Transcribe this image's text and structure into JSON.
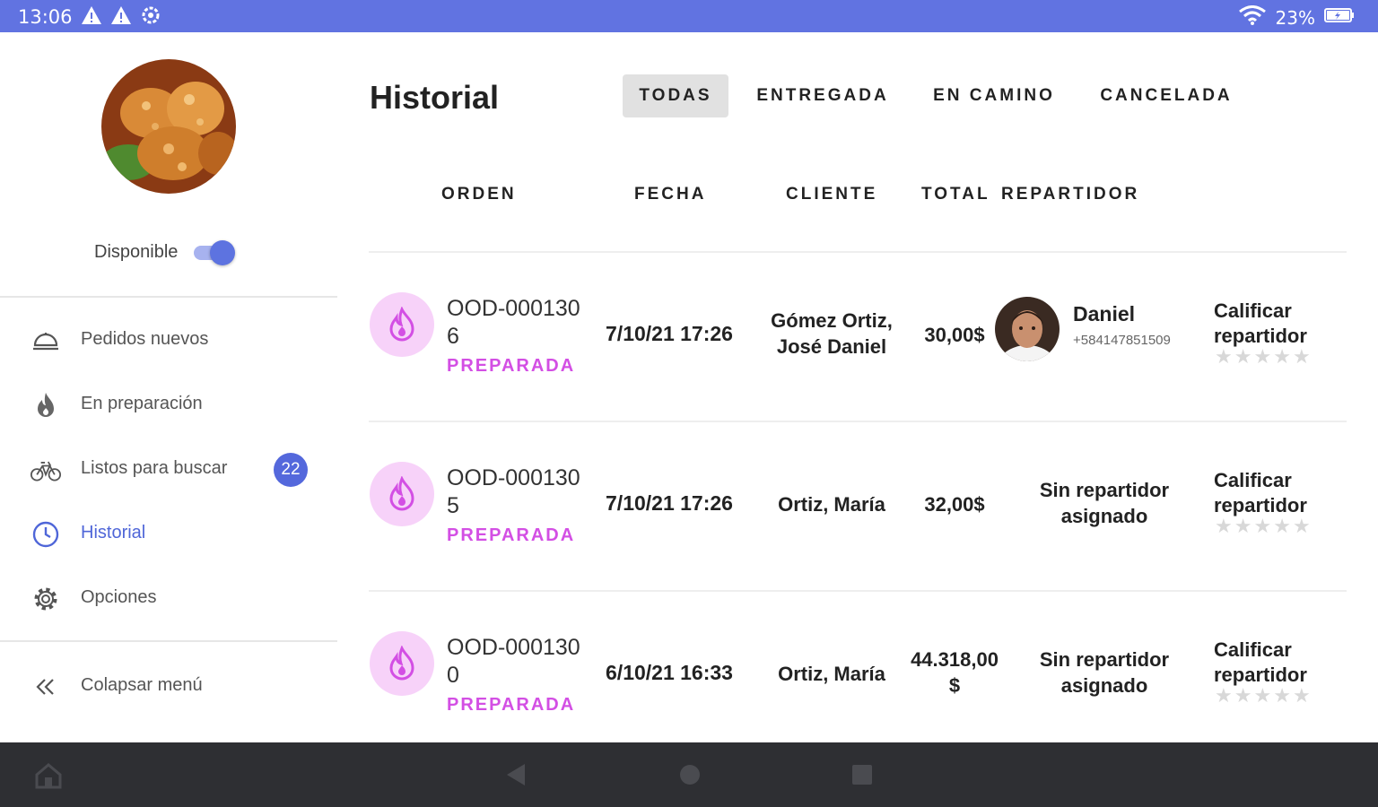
{
  "status_bar": {
    "time": "13:06",
    "battery": "23%",
    "icons": [
      "warning-icon",
      "warning-icon",
      "settings-icon",
      "wifi-icon",
      "battery-icon"
    ]
  },
  "sidebar": {
    "availability_label": "Disponible",
    "availability_on": true,
    "items": [
      {
        "label": "Pedidos nuevos",
        "icon": "cloche-icon"
      },
      {
        "label": "En preparación",
        "icon": "flame-icon"
      },
      {
        "label": "Listos para buscar",
        "icon": "bicycle-icon",
        "badge": "22"
      },
      {
        "label": "Historial",
        "icon": "clock-icon",
        "active": true
      },
      {
        "label": "Opciones",
        "icon": "gear-icon"
      }
    ],
    "collapse_label": "Colapsar menú"
  },
  "main": {
    "title": "Historial",
    "tabs": [
      {
        "label": "TODAS",
        "active": true
      },
      {
        "label": "ENTREGADA"
      },
      {
        "label": "EN CAMINO"
      },
      {
        "label": "CANCELADA"
      }
    ],
    "columns": [
      "ORDEN",
      "FECHA",
      "CLIENTE",
      "TOTAL",
      "REPARTIDOR"
    ],
    "orders": [
      {
        "order_id": "OOD-0001306",
        "status": "PREPARADA",
        "date": "7/10/21 17:26",
        "client": "Gómez Ortiz, José Daniel",
        "total": "30,00$",
        "courier_name": "Daniel",
        "courier_phone": "+584147851509",
        "rate_label": "Calificar repartidor",
        "stars": 5
      },
      {
        "order_id": "OOD-0001305",
        "status": "PREPARADA",
        "date": "7/10/21 17:26",
        "client": "Ortiz, María",
        "total": "32,00$",
        "no_courier": "Sin repartidor asignado",
        "rate_label": "Calificar repartidor",
        "stars": 5
      },
      {
        "order_id": "OOD-0001300",
        "status": "PREPARADA",
        "date": "6/10/21 16:33",
        "client": "Ortiz, María",
        "total": "44.318,00$",
        "no_courier": "Sin repartidor asignado",
        "rate_label": "Calificar repartidor",
        "stars": 5
      }
    ]
  },
  "colors": {
    "status_bar": "#6173e1",
    "accent": "#5468dc",
    "status_text": "#d34fe4",
    "order_icon_bg": "#f7d2f9",
    "nav_bar": "#2e2f33"
  }
}
